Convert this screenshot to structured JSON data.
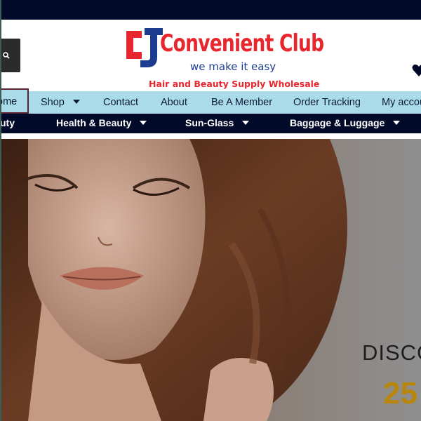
{
  "brand": {
    "name": "Convenient Club",
    "tagline": "we make it easy",
    "subtitle": "Hair and Beauty Supply Wholesale",
    "colors": {
      "red": "#e8262d",
      "blue": "#1c3d8f",
      "navy": "#020a2a",
      "nav_light": "#a9dbe8",
      "gold": "#b8860b"
    }
  },
  "header": {
    "search_icon": "search-icon",
    "wishlist_icon": "heart-icon"
  },
  "nav_primary": {
    "items": [
      {
        "label": "ome",
        "active": true
      },
      {
        "label": "Shop",
        "dropdown": true
      },
      {
        "label": "Contact"
      },
      {
        "label": "About"
      },
      {
        "label": "Be A Member"
      },
      {
        "label": "Order Tracking"
      },
      {
        "label": "My accou"
      }
    ]
  },
  "nav_categories": {
    "items": [
      {
        "label": "uty"
      },
      {
        "label": "Health & Beauty",
        "dropdown": true
      },
      {
        "label": "Sun-Glass",
        "dropdown": true
      },
      {
        "label": "Baggage & Luggage",
        "dropdown": true
      }
    ]
  },
  "hero": {
    "headline": "DISCO",
    "percent": "25"
  }
}
